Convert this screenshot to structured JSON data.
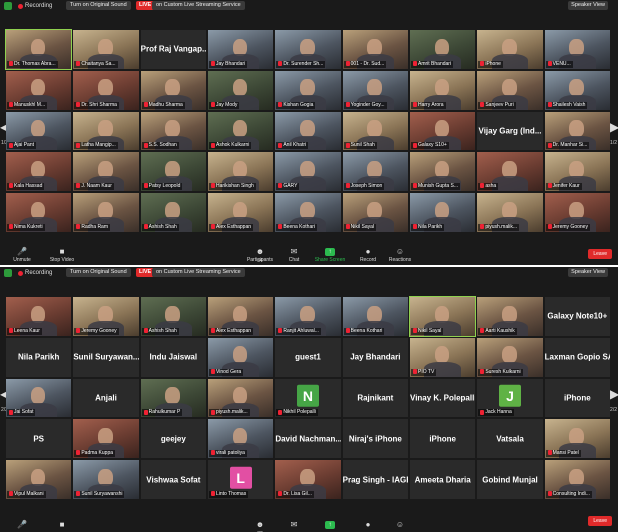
{
  "windows": [
    {
      "toolbar": {
        "recording": "Recording",
        "original_sound": "Turn on Original Sound",
        "live": "LIVE",
        "streaming": "on Custom Live Streaming Service",
        "speaker_view": "Speaker View"
      },
      "page_left": "1/2",
      "page_right": "1/2",
      "tiles": [
        {
          "type": "video",
          "name": "Dr. Thomas Abra...",
          "c": "c1",
          "active": true
        },
        {
          "type": "video",
          "name": "Chaitanya Sa...",
          "c": "c3"
        },
        {
          "type": "text",
          "big": "Prof Raj Vangap...",
          "name": ""
        },
        {
          "type": "video",
          "name": "Jay Bhandari",
          "c": "c2"
        },
        {
          "type": "video",
          "name": "Dr. Surender Sh...",
          "c": "c2"
        },
        {
          "type": "video",
          "name": "001 - Dr. Sud...",
          "c": "c1"
        },
        {
          "type": "video",
          "name": "Amrit Bhandari",
          "c": "c4"
        },
        {
          "type": "video",
          "name": "iPhone",
          "c": "c3"
        },
        {
          "type": "video",
          "name": "VENU...",
          "c": "c2"
        },
        {
          "type": "video",
          "name": "Manuskhl M...",
          "c": "c5"
        },
        {
          "type": "video",
          "name": "Dr. Shri Sharma",
          "c": "c5"
        },
        {
          "type": "video",
          "name": "Madhu Sharma",
          "c": "c1"
        },
        {
          "type": "video",
          "name": "Jay Mody",
          "c": "c4"
        },
        {
          "type": "video",
          "name": "Kishan Gogia",
          "c": "c2"
        },
        {
          "type": "video",
          "name": "Yoginder Goy...",
          "c": "c2"
        },
        {
          "type": "video",
          "name": "Harry Arora",
          "c": "c3"
        },
        {
          "type": "video",
          "name": "Sanjeev Puri",
          "c": "c1"
        },
        {
          "type": "video",
          "name": "Shailesh Vaish",
          "c": "c2"
        },
        {
          "type": "video",
          "name": "Ajai Pant",
          "c": "c2"
        },
        {
          "type": "video",
          "name": "Latha Mangip...",
          "c": "c3"
        },
        {
          "type": "video",
          "name": "S.S. Sodhan",
          "c": "c1"
        },
        {
          "type": "video",
          "name": "Ashok Kulkarni",
          "c": "c4"
        },
        {
          "type": "video",
          "name": "Anil Khatri",
          "c": "c2"
        },
        {
          "type": "video",
          "name": "Sunil Shah",
          "c": "c3"
        },
        {
          "type": "video",
          "name": "Galaxy S10+",
          "c": "c5"
        },
        {
          "type": "text",
          "big": "Vijay Garg (Ind...",
          "name": ""
        },
        {
          "type": "video",
          "name": "Dr. Manhar Si...",
          "c": "c1"
        },
        {
          "type": "video",
          "name": "Kala Hassad",
          "c": "c5"
        },
        {
          "type": "video",
          "name": "J. Naam Kaur",
          "c": "c1"
        },
        {
          "type": "video",
          "name": "Patsy Leopold",
          "c": "c4"
        },
        {
          "type": "video",
          "name": "Harikishan Singh",
          "c": "c3"
        },
        {
          "type": "video",
          "name": "GARY",
          "c": "c2"
        },
        {
          "type": "video",
          "name": "Joseph Simon",
          "c": "c2"
        },
        {
          "type": "video",
          "name": "Munish Gupta S...",
          "c": "c1"
        },
        {
          "type": "video",
          "name": "asha",
          "c": "c5"
        },
        {
          "type": "video",
          "name": "Jenifer Kaur",
          "c": "c3"
        },
        {
          "type": "video",
          "name": "Nima Kukreti",
          "c": "c5"
        },
        {
          "type": "video",
          "name": "Radha Ram",
          "c": "c1"
        },
        {
          "type": "video",
          "name": "Ashish Shah",
          "c": "c4"
        },
        {
          "type": "video",
          "name": "Alex Esthappan",
          "c": "c3"
        },
        {
          "type": "video",
          "name": "Beena Kothari",
          "c": "c2"
        },
        {
          "type": "video",
          "name": "Nikil Sayal",
          "c": "c1"
        },
        {
          "type": "video",
          "name": "Nila Parikh",
          "c": "c2"
        },
        {
          "type": "video",
          "name": "piyush.malik...",
          "c": "c3"
        },
        {
          "type": "video",
          "name": "Jeremy Gooney",
          "c": "c5"
        }
      ],
      "bottombar": {
        "unmute": "Unmute",
        "stop_video": "Stop Video",
        "participants": "Participants",
        "participants_count": "84",
        "chat": "Chat",
        "share": "Share Screen",
        "record": "Record",
        "reactions": "Reactions",
        "leave": "Leave"
      }
    },
    {
      "toolbar": {
        "recording": "Recording",
        "original_sound": "Turn on Original Sound",
        "live": "LIVE",
        "streaming": "on Custom Live Streaming Service",
        "speaker_view": "Speaker View"
      },
      "page_left": "2/2",
      "page_right": "2/2",
      "tiles": [
        {
          "type": "video",
          "name": "Leena Kaur",
          "c": "c5"
        },
        {
          "type": "video",
          "name": "Jeremy Gooney",
          "c": "c3"
        },
        {
          "type": "video",
          "name": "Ashish Shah",
          "c": "c4"
        },
        {
          "type": "video",
          "name": "Alex Esthappan",
          "c": "c1"
        },
        {
          "type": "video",
          "name": "Ranjit Ahluwal...",
          "c": "c2"
        },
        {
          "type": "video",
          "name": "Beena Kothari",
          "c": "c2"
        },
        {
          "type": "video",
          "name": "Nikil Sayal",
          "c": "c3",
          "active": true
        },
        {
          "type": "video",
          "name": "Aarti Kaushik",
          "c": "c1"
        },
        {
          "type": "text",
          "big": "Galaxy Note10+",
          "name": ""
        },
        {
          "type": "text",
          "big": "Nila Parikh",
          "name": ""
        },
        {
          "type": "text",
          "big": "Sunil Suryawan...",
          "name": ""
        },
        {
          "type": "text",
          "big": "Indu Jaiswal",
          "name": ""
        },
        {
          "type": "video",
          "name": "Vinod Gera",
          "c": "c2"
        },
        {
          "type": "text",
          "big": "guest1",
          "name": ""
        },
        {
          "type": "text",
          "big": "Jay Bhandari",
          "name": ""
        },
        {
          "type": "video",
          "name": "PIO TV",
          "c": "c3"
        },
        {
          "type": "video",
          "name": "Suresh Kulkarni",
          "c": "c1"
        },
        {
          "type": "text",
          "big": "Laxman Gopio SA",
          "name": ""
        },
        {
          "type": "video",
          "name": "Jai Sofat",
          "c": "c2"
        },
        {
          "type": "text",
          "big": "Anjali",
          "name": ""
        },
        {
          "type": "video",
          "name": "Rahulkumar P",
          "c": "c4"
        },
        {
          "type": "video",
          "name": "piyush.malik...",
          "c": "c1"
        },
        {
          "type": "avatar",
          "avatar": "N",
          "color": "#46a546",
          "name": "Nikhil Polepalli"
        },
        {
          "type": "text",
          "big": "Rajnikant",
          "name": ""
        },
        {
          "type": "text",
          "big": "Vinay K. Polepalli",
          "name": ""
        },
        {
          "type": "avatar",
          "avatar": "J",
          "color": "#5fb245",
          "name": "Jack Hanna"
        },
        {
          "type": "text",
          "big": "iPhone",
          "name": ""
        },
        {
          "type": "text",
          "big": "PS",
          "name": ""
        },
        {
          "type": "video",
          "name": "Padma Kuppa",
          "c": "c5"
        },
        {
          "type": "text",
          "big": "geejey",
          "name": ""
        },
        {
          "type": "video",
          "name": "virali patoliya",
          "c": "c2"
        },
        {
          "type": "text",
          "big": "David Nachman...",
          "name": ""
        },
        {
          "type": "text",
          "big": "Niraj's iPhone",
          "name": ""
        },
        {
          "type": "text",
          "big": "iPhone",
          "name": ""
        },
        {
          "type": "text",
          "big": "Vatsala",
          "name": ""
        },
        {
          "type": "video",
          "name": "Mansi Patel",
          "c": "c3"
        },
        {
          "type": "video",
          "name": "Vipul Malkani",
          "c": "c1"
        },
        {
          "type": "video",
          "name": "Sunil Suryawanshi",
          "c": "c2"
        },
        {
          "type": "text",
          "big": "Vishwaa Sofat",
          "name": ""
        },
        {
          "type": "avatar",
          "avatar": "L",
          "color": "#e24fa3",
          "name": "Linto Thomas"
        },
        {
          "type": "video",
          "name": "Dr. Lisa Gil...",
          "c": "c5"
        },
        {
          "type": "text",
          "big": "Prag Singh - IAGB",
          "name": ""
        },
        {
          "type": "text",
          "big": "Ameeta Dharia",
          "name": ""
        },
        {
          "type": "text",
          "big": "Gobind Munjal",
          "name": ""
        },
        {
          "type": "video",
          "name": "Consulting Indi...",
          "c": "c1"
        }
      ],
      "bottombar": {
        "unmute": "",
        "stop_video": "",
        "participants": "",
        "participants_count": "82",
        "chat": "",
        "share": "",
        "record": "",
        "reactions": "",
        "leave": "Leave"
      }
    }
  ]
}
